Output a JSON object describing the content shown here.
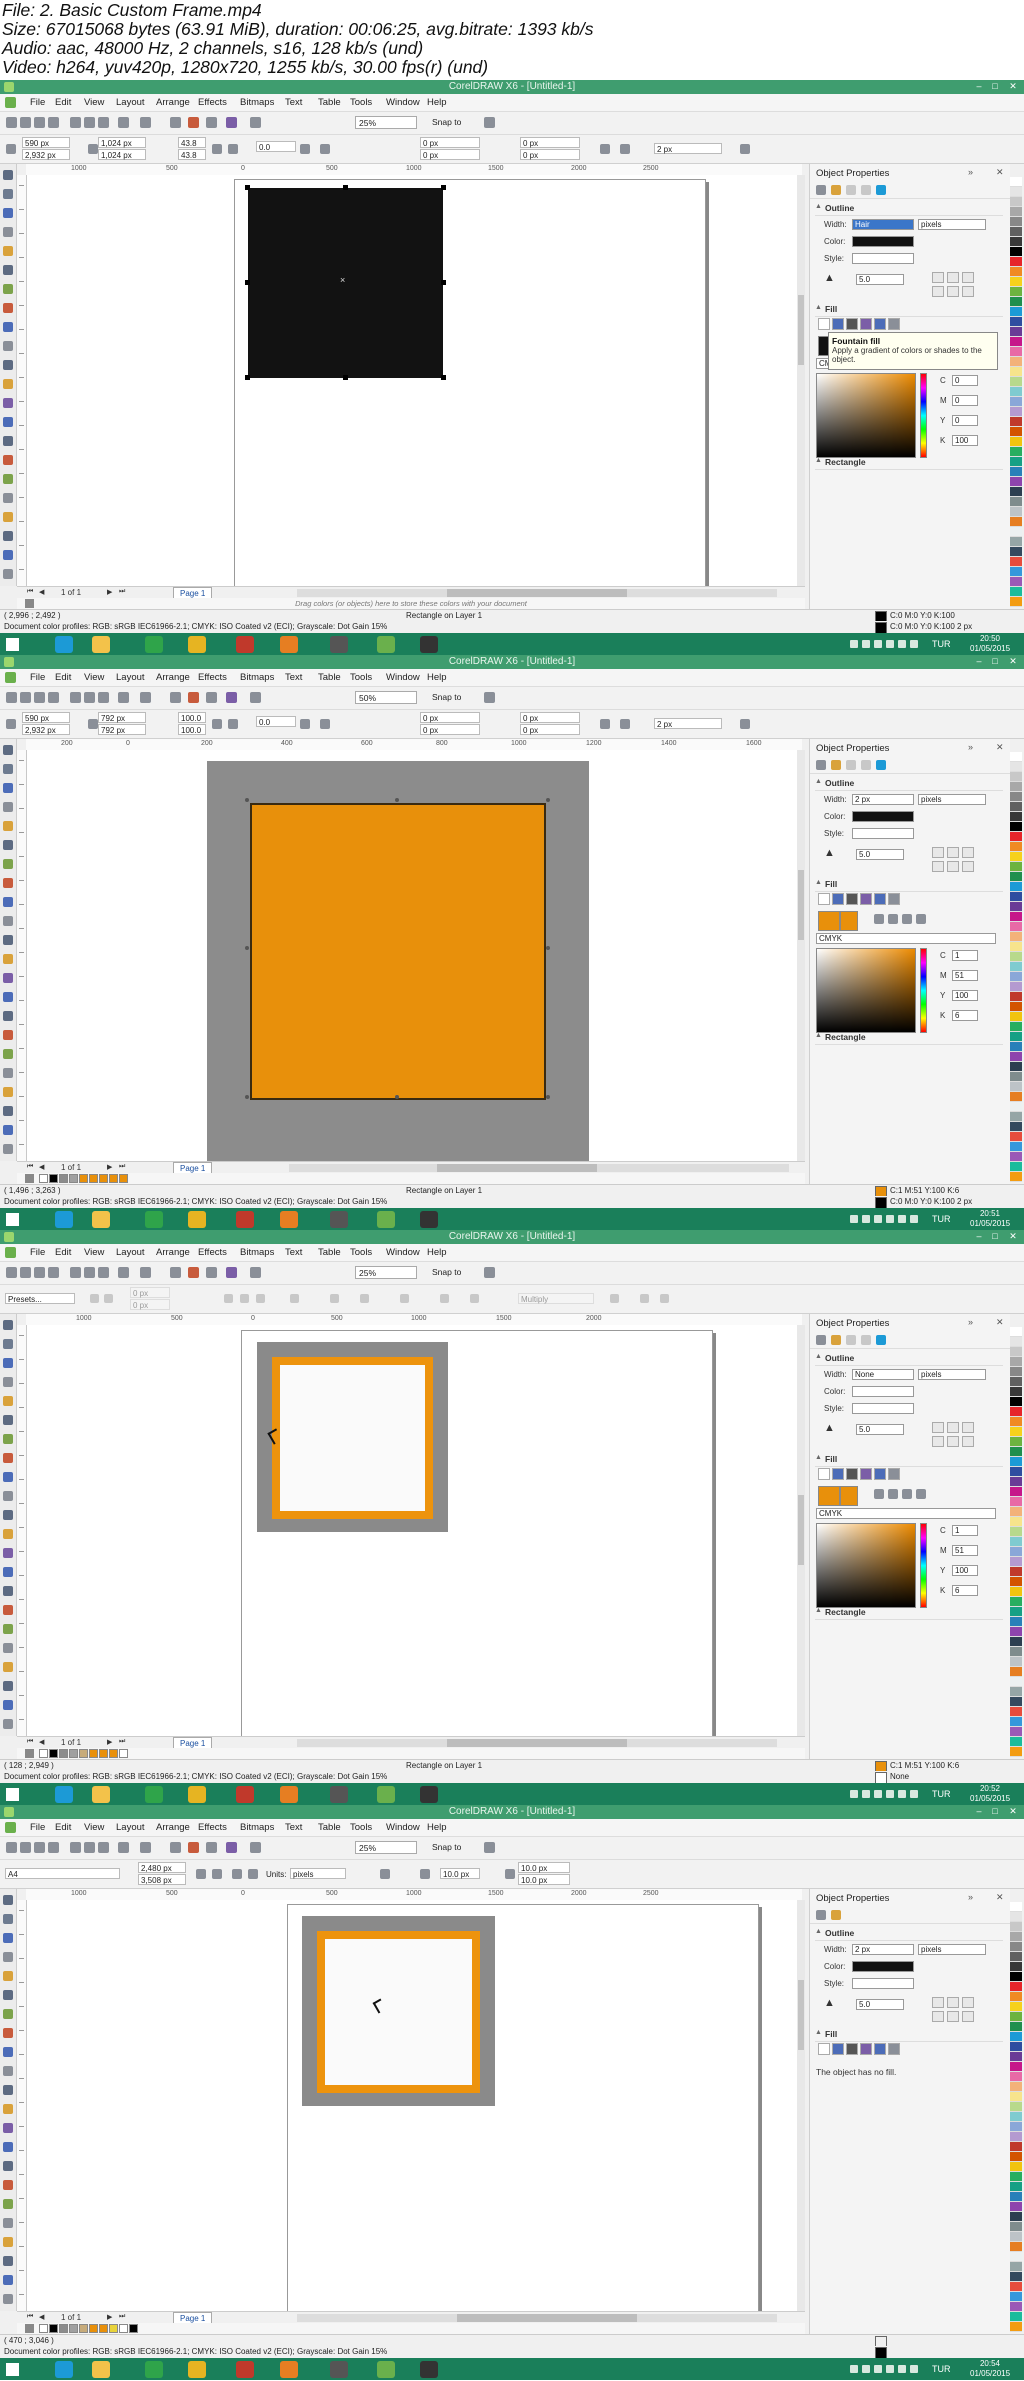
{
  "video_info": {
    "line1": "File: 2. Basic Custom Frame.mp4",
    "line2": "Size: 67015068 bytes (63.91 MiB), duration: 00:06:25, avg.bitrate: 1393 kb/s",
    "line3": "Audio: aac, 48000 Hz, 2 channels, s16, 128 kb/s (und)",
    "line4": "Video: h264, yuv420p, 1280x720, 1255 kb/s, 30.00 fps(r) (und)"
  },
  "app": {
    "title": "CorelDRAW X6 - [Untitled-1]",
    "menu": [
      "File",
      "Edit",
      "View",
      "Layout",
      "Arrange",
      "Effects",
      "Bitmaps",
      "Text",
      "Table",
      "Tools",
      "Window",
      "Help"
    ],
    "snap_to": "Snap to",
    "docker_title": "Object Properties",
    "outline_label": "Outline",
    "fill_label": "Fill",
    "rectangle_label": "Rectangle",
    "width_label": "Width:",
    "color_label": "Color:",
    "style_label": "Style:",
    "units_value": "pixels",
    "miter_value": "5.0",
    "cmyk_label": "CMYK",
    "page_count": "1 of 1",
    "page_tab": "Page 1",
    "color_profiles": "Document color profiles: RGB: sRGB IEC61966-2.1; CMYK: ISO Coated v2 (ECI); Grayscale: Dot Gain 15%",
    "drag_hint": "Drag colors (or objects) here to store these colors with your document",
    "language": "TUR"
  },
  "frames": [
    {
      "zoom": "25%",
      "pos_x": "590 px",
      "pos_y": "2,932 px",
      "size_w": "1,024 px",
      "size_h": "1,024 px",
      "scale_x": "43.8",
      "scale_y": "43.8",
      "rotation": "0.0",
      "corner_a": "0 px",
      "corner_b": "0 px",
      "outline_width_tb": "2 px",
      "ruler": [
        "1000",
        "500",
        "0",
        "500",
        "1000",
        "1500",
        "2000",
        "2500"
      ],
      "outline_width": "Hair",
      "coords": "( 2,996 ; 2,492 )",
      "layer_info": "Rectangle on Layer 1",
      "status_fill": "C:0 M:0 Y:0 K:100",
      "status_outline": "C:0 M:0 Y:0 K:100  2 px",
      "clock_time": "20:50",
      "clock_date": "01/05/2015",
      "tooltip_title": "Fountain fill",
      "tooltip_text": "Apply a gradient of colors or shades to the object.",
      "cmyk": {
        "C": "0",
        "M": "0",
        "Y": "0",
        "K": "100"
      }
    },
    {
      "zoom": "50%",
      "pos_x": "590 px",
      "pos_y": "2,932 px",
      "size_w": "792 px",
      "size_h": "792 px",
      "scale_x": "100.0",
      "scale_y": "100.0",
      "rotation": "0.0",
      "corner_a": "0 px",
      "corner_b": "0 px",
      "outline_width_tb": "2 px",
      "ruler": [
        "200",
        "0",
        "200",
        "400",
        "600",
        "800",
        "1000",
        "1200",
        "1400",
        "1600"
      ],
      "outline_width": "2 px",
      "coords": "( 1,496 ; 3,263 )",
      "layer_info": "Rectangle on Layer 1",
      "status_fill": "C:1 M:51 Y:100 K:6",
      "status_outline": "C:0 M:0 Y:0 K:100  2 px",
      "clock_time": "20:51",
      "clock_date": "01/05/2015",
      "cmyk": {
        "C": "1",
        "M": "51",
        "Y": "100",
        "K": "6"
      }
    },
    {
      "zoom": "25%",
      "presets": "Presets...",
      "prop_a": "0 px",
      "prop_b": "0 px",
      "prop_c": "0 px",
      "blend_mode": "Multiply",
      "ruler": [
        "1000",
        "500",
        "0",
        "500",
        "1000",
        "1500",
        "2000"
      ],
      "outline_width": "None",
      "coords": "( 128 ; 2,949 )",
      "layer_info": "Rectangle on Layer 1",
      "status_fill": "C:1 M:51 Y:100 K:6",
      "status_outline": "None",
      "clock_time": "20:52",
      "clock_date": "01/05/2015",
      "cmyk": {
        "C": "1",
        "M": "51",
        "Y": "100",
        "K": "6"
      }
    },
    {
      "zoom": "25%",
      "paper": "A4",
      "page_w": "2,480 px",
      "page_h": "3,508 px",
      "units_label": "Units:",
      "units": "pixels",
      "nudge": "10.0 px",
      "dup_x": "10.0 px",
      "dup_y": "10.0 px",
      "ruler": [
        "1000",
        "500",
        "0",
        "500",
        "1000",
        "1500",
        "2000",
        "2500"
      ],
      "outline_width": "2 px",
      "no_fill_text": "The object has no fill.",
      "coords": "( 470 ; 3,046 )",
      "clock_time": "20:54",
      "clock_date": "01/05/2015"
    }
  ]
}
